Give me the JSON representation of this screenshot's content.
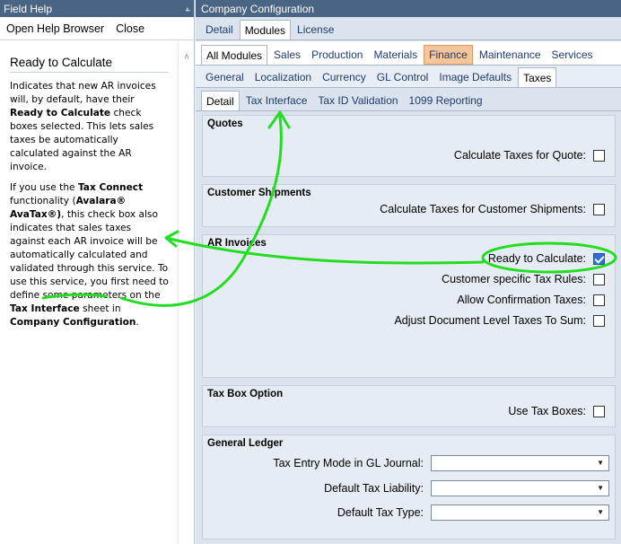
{
  "field_help": {
    "title": "Field Help",
    "pin_icon": "pin-icon",
    "toolbar": {
      "open_browser": "Open Help Browser",
      "close": "Close"
    },
    "heading": "Ready to Calculate",
    "p1_a": "Indicates that new AR invoices will, by default, have their ",
    "p1_b": "Ready to Calculate",
    "p1_c": " check boxes selected. This lets sales taxes be automatically calculated against the AR invoice.",
    "p2_a": "If you use the ",
    "p2_b": "Tax Connect",
    "p2_c": " functionality (",
    "p2_d": "Avalara® AvaTax®)",
    "p2_e": ", this check box also indicates that sales taxes against each AR invoice will be automatically calculated and validated through this service. To use this service, you first need to define some parameters on the ",
    "p2_f": "Tax Interface",
    "p2_g": " sheet in ",
    "p2_h": "Company Configuration",
    "p2_i": "."
  },
  "company_config": {
    "title": "Company Configuration",
    "tabs_row1": [
      "Detail",
      "Modules",
      "License"
    ],
    "tabs_row2": [
      "All Modules",
      "Sales",
      "Production",
      "Materials",
      "Finance",
      "Maintenance",
      "Services"
    ],
    "tabs_row3": [
      "General",
      "Localization",
      "Currency",
      "GL Control",
      "Image Defaults",
      "Taxes"
    ],
    "tabs_row4": [
      "Detail",
      "Tax Interface",
      "Tax ID Validation",
      "1099 Reporting"
    ],
    "groups": {
      "quotes": {
        "title": "Quotes",
        "calc_quote": "Calculate Taxes for Quote:"
      },
      "shipments": {
        "title": "Customer Shipments",
        "calc_ship": "Calculate Taxes for Customer Shipments:"
      },
      "ar": {
        "title": "AR Invoices",
        "ready": "Ready to Calculate:",
        "cust_rules": "Customer specific Tax Rules:",
        "allow_conf": "Allow Confirmation Taxes:",
        "adjust": "Adjust Document Level Taxes To Sum:"
      },
      "taxbox": {
        "title": "Tax Box Option",
        "use_tax_boxes": "Use Tax Boxes:"
      },
      "gl": {
        "title": "General Ledger",
        "entry_mode": "Tax Entry Mode in GL Journal:",
        "liability": "Default Tax Liability:",
        "tax_type": "Default Tax Type:"
      }
    },
    "ready_to_calculate_checked": true
  },
  "colors": {
    "annotation": "#22dd22",
    "titlebar": "#4a6484",
    "finance_tab": "#f7c59a"
  }
}
